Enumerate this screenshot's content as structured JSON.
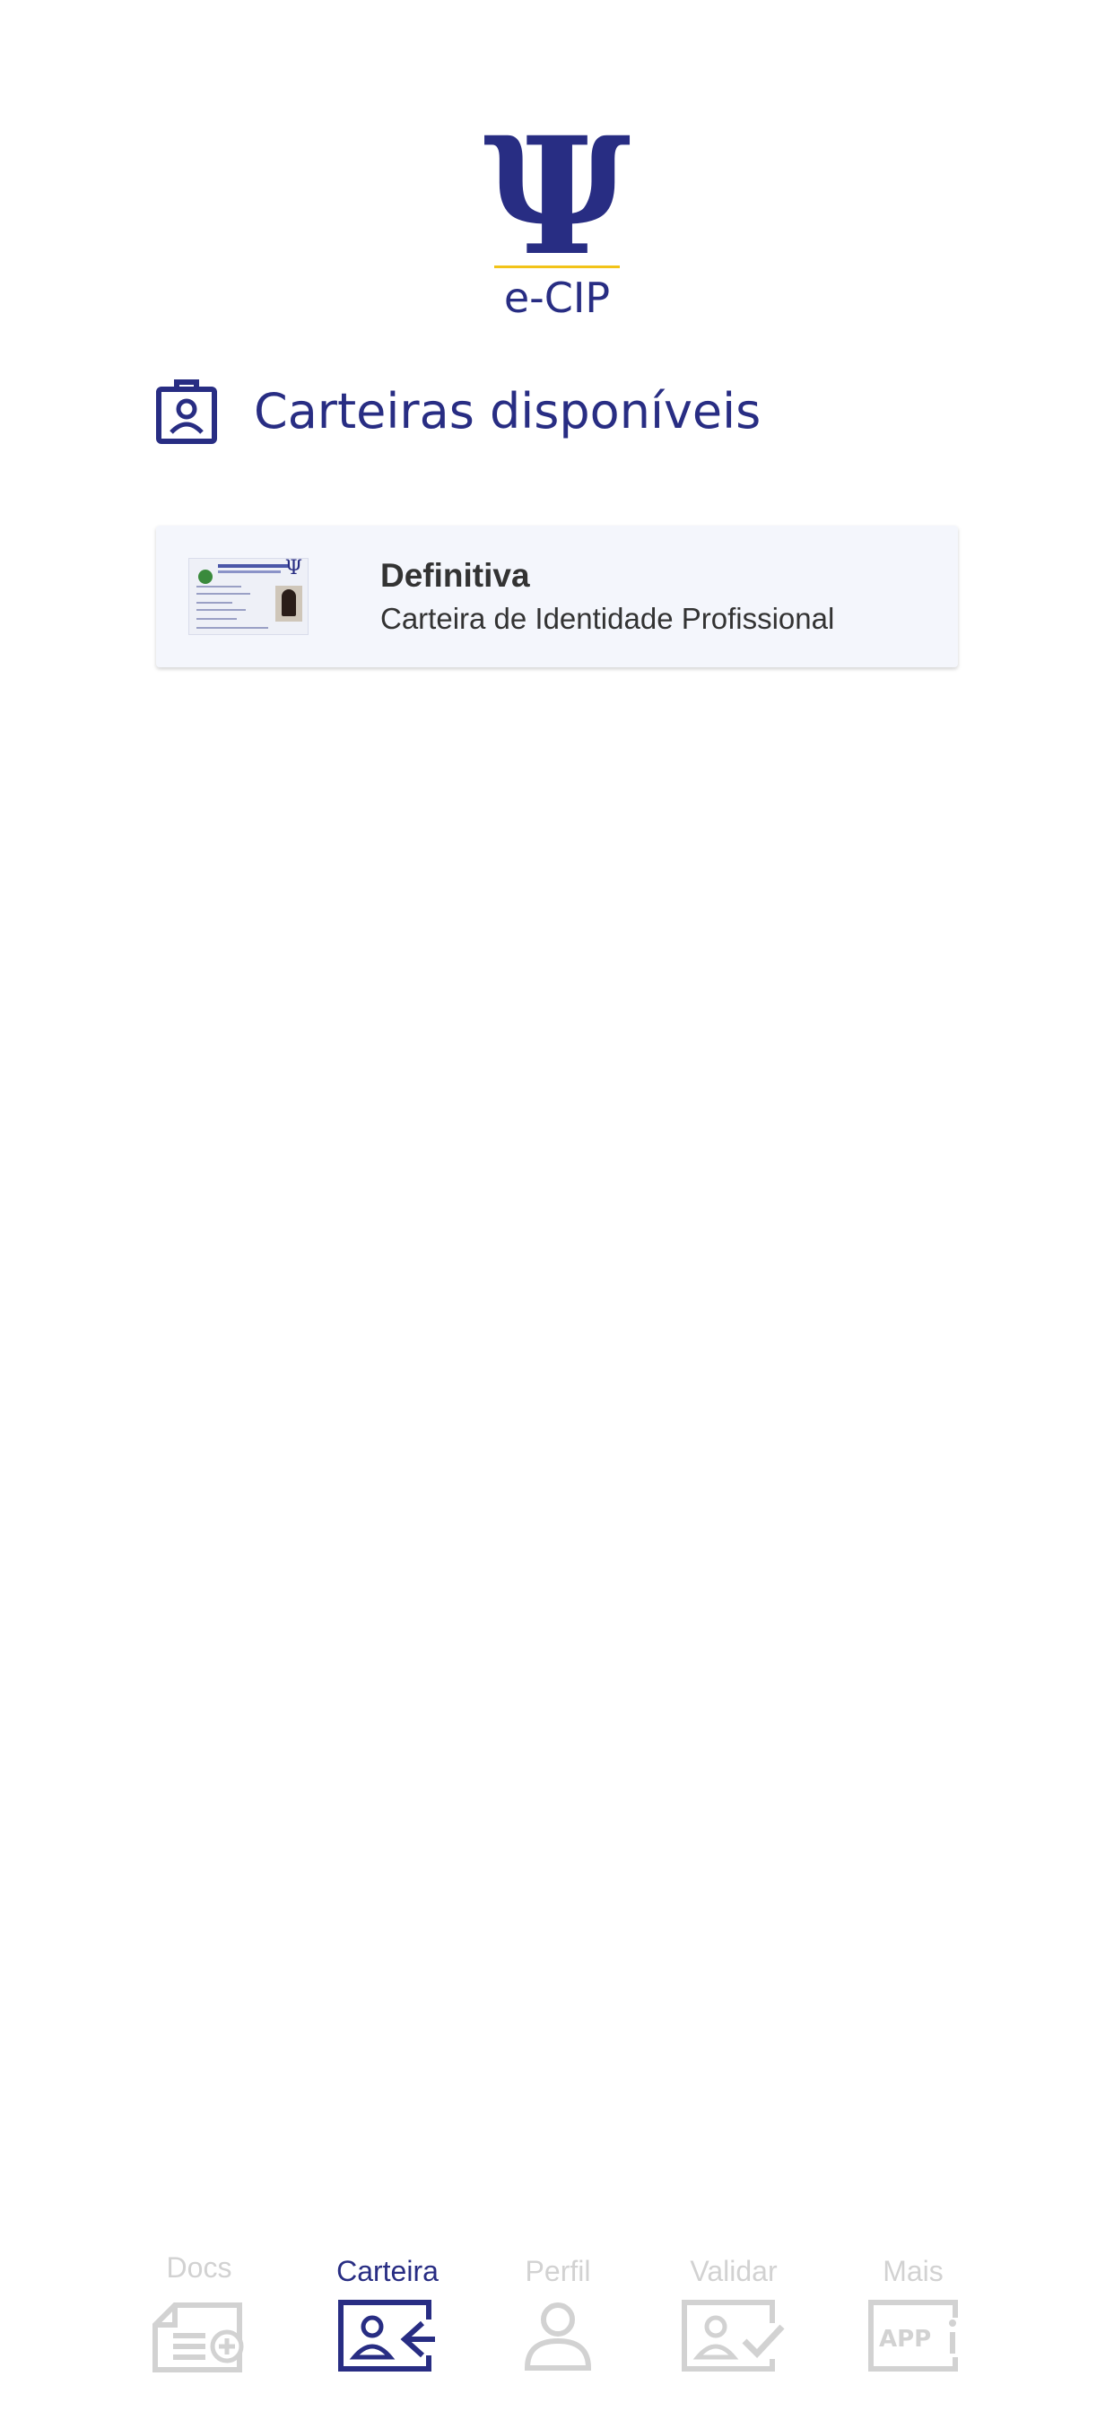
{
  "logo": {
    "symbol": "Ψ",
    "text": "e-CIP"
  },
  "section": {
    "title": "Carteiras disponíveis",
    "icon": "id-badge-icon"
  },
  "cards": [
    {
      "title": "Definitiva",
      "subtitle": "Carteira de Identidade Profissional",
      "thumbnail": "id-card-thumbnail"
    }
  ],
  "tabs": [
    {
      "label": "Docs",
      "icon": "document-add-icon",
      "active": false
    },
    {
      "label": "Carteira",
      "icon": "id-card-person-icon",
      "active": true
    },
    {
      "label": "Perfil",
      "icon": "person-icon",
      "active": false
    },
    {
      "label": "Validar",
      "icon": "id-check-icon",
      "active": false
    },
    {
      "label": "Mais",
      "icon": "app-info-icon",
      "active": false
    }
  ],
  "colors": {
    "brand": "#282d83",
    "accent": "#f2c318",
    "inactive": "#d2d2d2",
    "card_bg": "#f4f6fc"
  }
}
